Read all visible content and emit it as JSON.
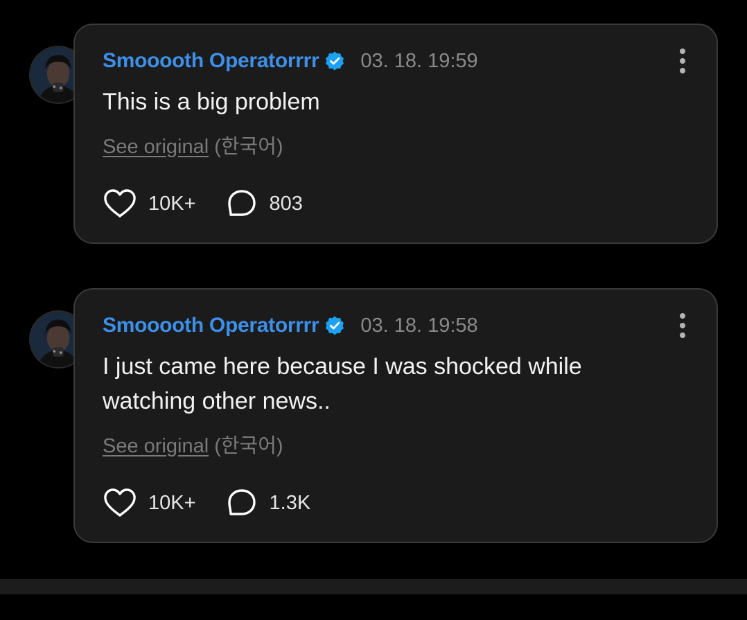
{
  "comments": [
    {
      "username": "Smooooth Operatorrrr",
      "timestamp": "03. 18. 19:59",
      "text": "This is a big problem",
      "see_original_link": "See original",
      "see_original_lang": "(한국어)",
      "likes": "10K+",
      "replies": "803"
    },
    {
      "username": "Smooooth Operatorrrr",
      "timestamp": "03. 18. 19:58",
      "text": "I just came here because I was shocked while watching other news..",
      "see_original_link": "See original",
      "see_original_lang": "(한국어)",
      "likes": "10K+",
      "replies": "1.3K"
    }
  ],
  "icons": {
    "verified": "verified-badge-icon",
    "like": "heart-icon",
    "reply": "speech-bubble-icon",
    "more": "more-vertical-icon"
  },
  "colors": {
    "background": "#000000",
    "card": "#1b1b1b",
    "card_border": "#3a3a3a",
    "username": "#3d8fe8",
    "verified_badge": "#1da1f2",
    "timestamp": "#8a8a8a",
    "body_text": "#f2f2f2"
  }
}
